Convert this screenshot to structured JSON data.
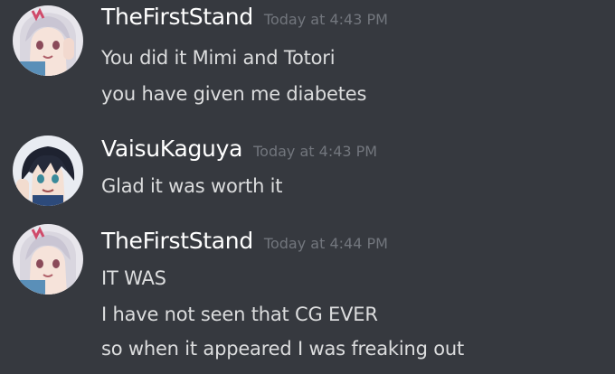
{
  "messages": [
    {
      "username": "TheFirstStand",
      "timestamp": "Today at 4:43 PM",
      "avatar": "silver-hair-girl-avatar",
      "lines": [
        "You did it Mimi and Totori",
        "you have given me diabetes"
      ]
    },
    {
      "username": "VaisuKaguya",
      "timestamp": "Today at 4:43 PM",
      "avatar": "dark-hair-boy-avatar",
      "lines": [
        "Glad it was worth it"
      ]
    },
    {
      "username": "TheFirstStand",
      "timestamp": "Today at 4:44 PM",
      "avatar": "silver-hair-girl-avatar",
      "lines": [
        "IT WAS",
        "I have not seen that CG EVER",
        "so when it appeared I was freaking out"
      ]
    }
  ],
  "colors": {
    "background": "#36393f",
    "username": "#ffffff",
    "timestamp": "#72767d",
    "message_text": "#dcddde"
  }
}
